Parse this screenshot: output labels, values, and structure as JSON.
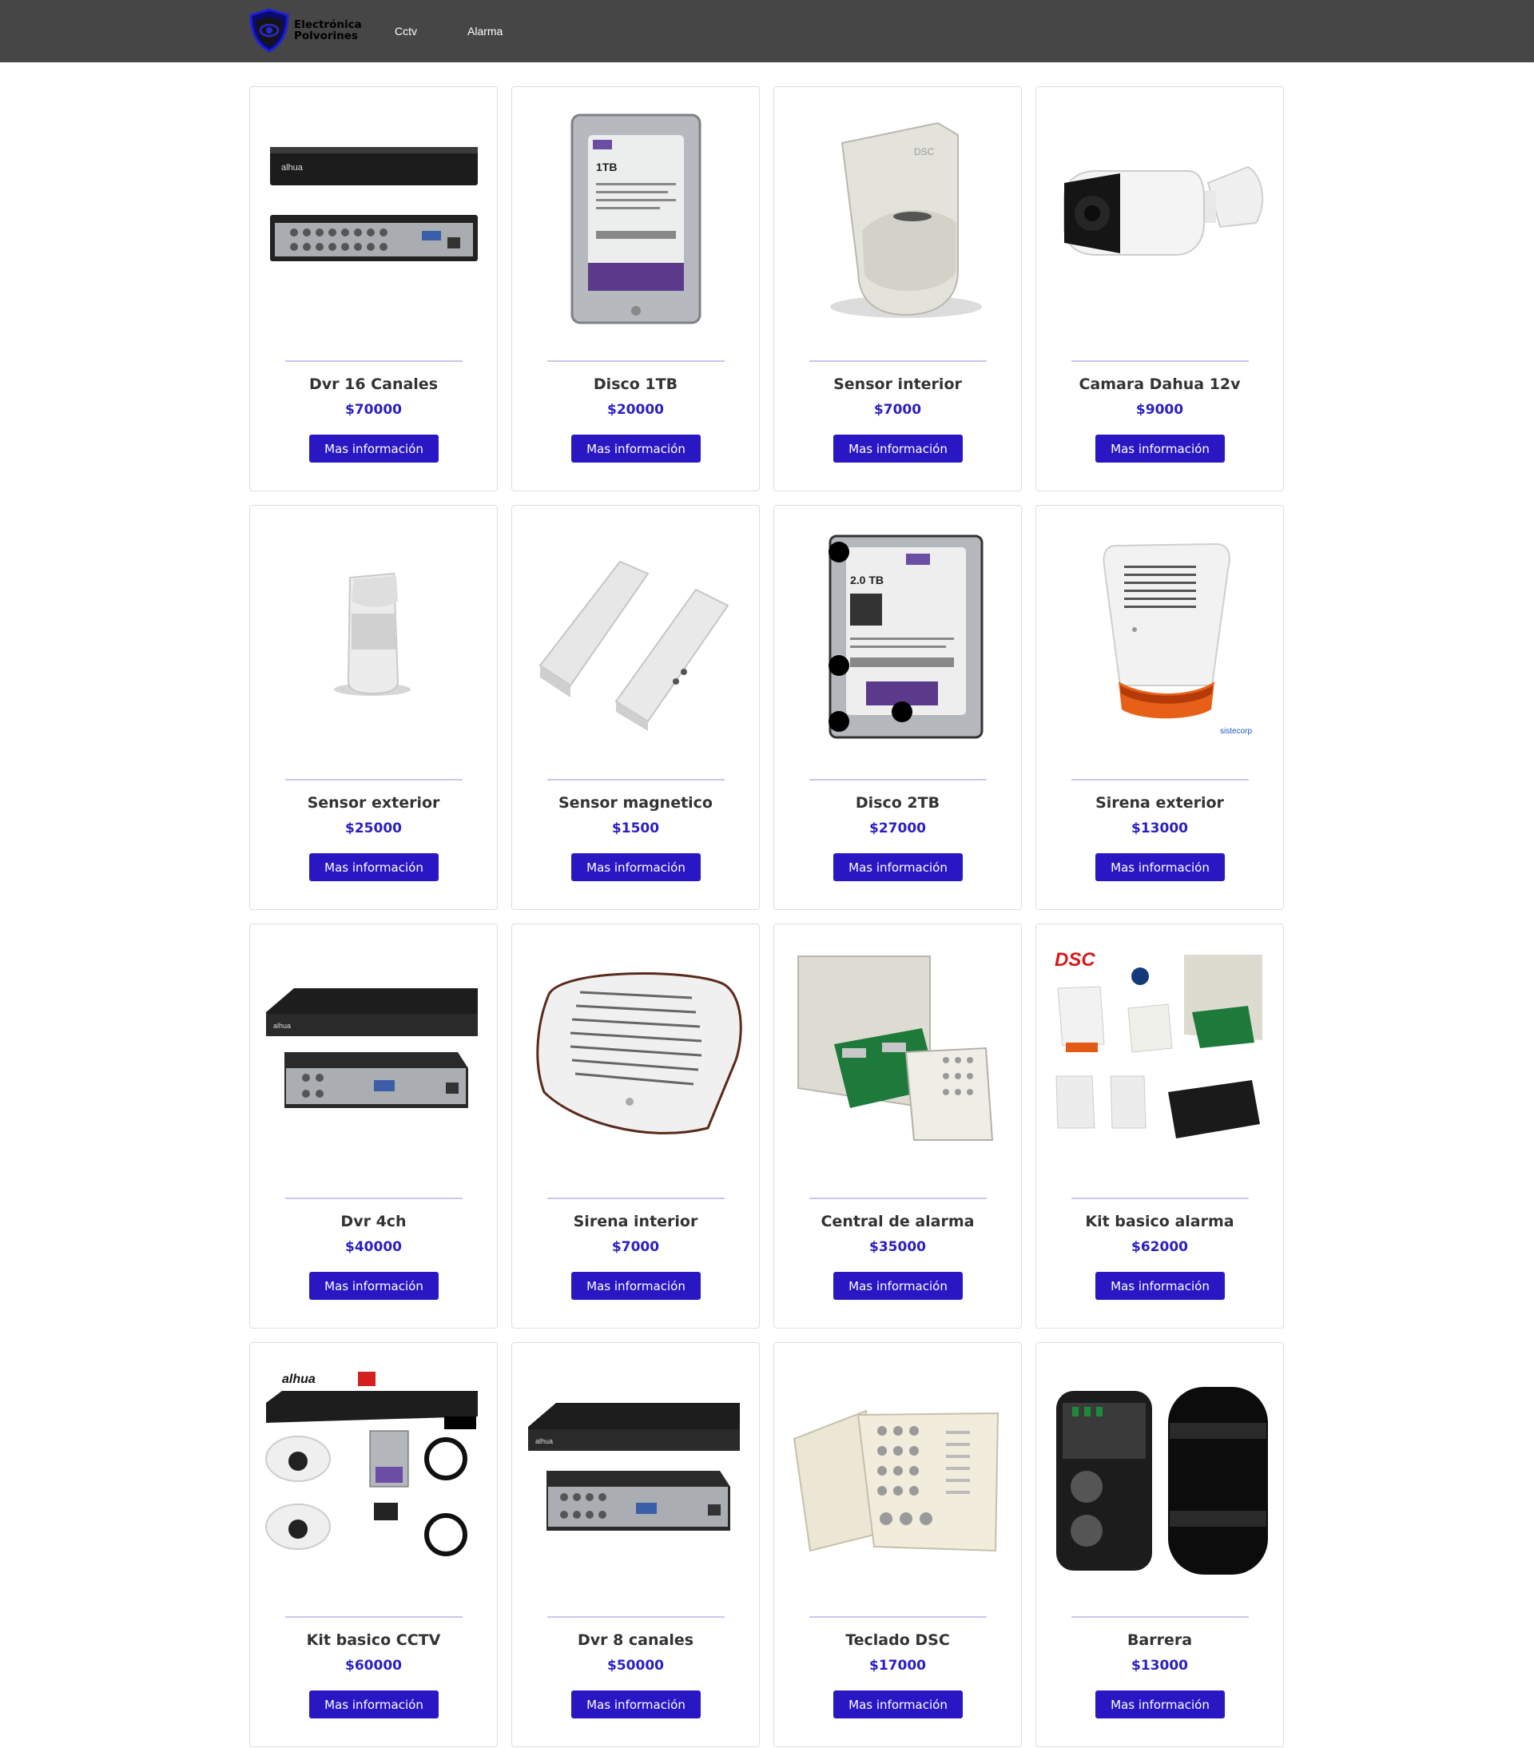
{
  "header": {
    "brand_line1": "Electrónica",
    "brand_line2": "Polvorines",
    "logo_icon": "shield-eye-logo",
    "nav": [
      {
        "label": "Cctv"
      },
      {
        "label": "Alarma"
      }
    ]
  },
  "colors": {
    "navbar": "#464646",
    "price": "#2b1fc0",
    "button": "#2a17c4",
    "divider": "#c9c7ee"
  },
  "products": [
    {
      "title": "Dvr 16 Canales",
      "price": "$70000",
      "button": "Mas información",
      "image": "dvr-16-channel-image"
    },
    {
      "title": "Disco 1TB",
      "price": "$20000",
      "button": "Mas información",
      "image": "hard-drive-1tb-image"
    },
    {
      "title": "Sensor interior",
      "price": "$7000",
      "button": "Mas información",
      "image": "indoor-motion-sensor-image"
    },
    {
      "title": "Camara Dahua 12v",
      "price": "$9000",
      "button": "Mas información",
      "image": "bullet-camera-image"
    },
    {
      "title": "Sensor exterior",
      "price": "$25000",
      "button": "Mas información",
      "image": "outdoor-motion-sensor-image"
    },
    {
      "title": "Sensor magnetico",
      "price": "$1500",
      "button": "Mas información",
      "image": "magnetic-contact-sensor-image"
    },
    {
      "title": "Disco 2TB",
      "price": "$27000",
      "button": "Mas información",
      "image": "hard-drive-2tb-image"
    },
    {
      "title": "Sirena exterior",
      "price": "$13000",
      "button": "Mas información",
      "image": "outdoor-siren-image"
    },
    {
      "title": "Dvr 4ch",
      "price": "$40000",
      "button": "Mas información",
      "image": "dvr-4-channel-image"
    },
    {
      "title": "Sirena interior",
      "price": "$7000",
      "button": "Mas información",
      "image": "indoor-siren-image"
    },
    {
      "title": "Central de alarma",
      "price": "$35000",
      "button": "Mas información",
      "image": "alarm-panel-image"
    },
    {
      "title": "Kit basico alarma",
      "price": "$62000",
      "button": "Mas información",
      "image": "alarm-kit-image"
    },
    {
      "title": "Kit basico CCTV",
      "price": "$60000",
      "button": "Mas información",
      "image": "cctv-kit-image"
    },
    {
      "title": "Dvr 8 canales",
      "price": "$50000",
      "button": "Mas información",
      "image": "dvr-8-channel-image"
    },
    {
      "title": "Teclado DSC",
      "price": "$17000",
      "button": "Mas información",
      "image": "dsc-keypad-image"
    },
    {
      "title": "Barrera",
      "price": "$13000",
      "button": "Mas información",
      "image": "infrared-barrier-image"
    }
  ]
}
